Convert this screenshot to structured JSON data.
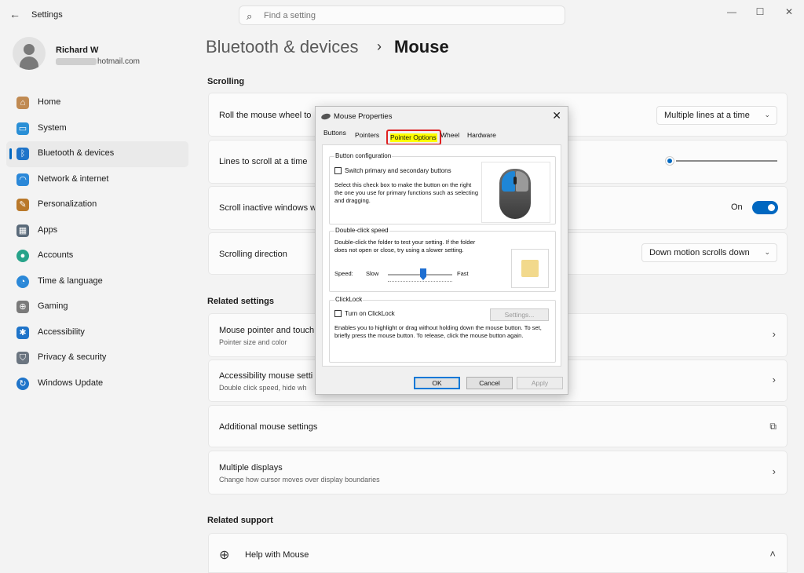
{
  "window": {
    "back_icon": "back-arrow-icon",
    "title": "Settings",
    "search_placeholder": "Find a setting",
    "controls": [
      "—",
      "☐",
      "✕"
    ]
  },
  "profile": {
    "name": "Richard W",
    "email_suffix": "hotmail.com"
  },
  "sidebar": {
    "items": [
      {
        "label": "Home",
        "icon": "home-icon",
        "color": "#c08a52"
      },
      {
        "label": "System",
        "icon": "system-icon",
        "color": "#2a8fd6"
      },
      {
        "label": "Bluetooth & devices",
        "icon": "bluetooth-icon",
        "color": "#1f74c9",
        "active": true
      },
      {
        "label": "Network & internet",
        "icon": "wifi-icon",
        "color": "#2b88d8"
      },
      {
        "label": "Personalization",
        "icon": "brush-icon",
        "color": "#b9782a"
      },
      {
        "label": "Apps",
        "icon": "apps-icon",
        "color": "#5a6a7a"
      },
      {
        "label": "Accounts",
        "icon": "accounts-icon",
        "color": "#27a38a"
      },
      {
        "label": "Time & language",
        "icon": "globe-clock-icon",
        "color": "#2b88d8"
      },
      {
        "label": "Gaming",
        "icon": "gamepad-icon",
        "color": "#7a7a7a"
      },
      {
        "label": "Accessibility",
        "icon": "accessibility-icon",
        "color": "#1f74c9"
      },
      {
        "label": "Privacy & security",
        "icon": "shield-icon",
        "color": "#6b7580"
      },
      {
        "label": "Windows Update",
        "icon": "update-icon",
        "color": "#1f74c9"
      }
    ]
  },
  "header": {
    "breadcrumb_parent": "Bluetooth & devices",
    "separator": "›",
    "page_title": "Mouse"
  },
  "scrolling": {
    "section_title": "Scrolling",
    "roll_label": "Roll the mouse wheel to",
    "roll_value": "Multiple lines at a time",
    "lines_label": "Lines to scroll at a time",
    "inactive_label": "Scroll inactive windows w",
    "inactive_state": "On",
    "direction_label": "Scrolling direction",
    "direction_value": "Down motion scrolls down"
  },
  "related_settings": {
    "section_title": "Related settings",
    "pointer_title": "Mouse pointer and touch",
    "pointer_sub": "Pointer size and color",
    "access_title": "Accessibility mouse setti",
    "access_sub": "Double click speed, hide wh",
    "additional_title": "Additional mouse settings",
    "displays_title": "Multiple displays",
    "displays_sub": "Change how cursor moves over display boundaries"
  },
  "related_support": {
    "section_title": "Related support",
    "help_title": "Help with Mouse"
  },
  "dialog": {
    "title": "Mouse Properties",
    "tabs": [
      "Buttons",
      "Pointers",
      "Pointer Options",
      "Wheel",
      "Hardware"
    ],
    "button_config": {
      "title": "Button configuration",
      "checkbox_label": "Switch primary and secondary buttons",
      "desc": "Select this check box to make the button on the right the one you use for primary functions such as selecting and dragging."
    },
    "double_click": {
      "title": "Double-click speed",
      "desc": "Double-click the folder to test your setting. If the folder does not open or close, try using a slower setting.",
      "speed_label": "Speed:",
      "slow": "Slow",
      "fast": "Fast"
    },
    "clicklock": {
      "title": "ClickLock",
      "checkbox_label": "Turn on ClickLock",
      "settings_button": "Settings...",
      "desc": "Enables you to highlight or drag without holding down the mouse button. To set, briefly press the mouse button. To release, click the mouse button again."
    },
    "buttons": {
      "ok": "OK",
      "cancel": "Cancel",
      "apply": "Apply"
    }
  }
}
